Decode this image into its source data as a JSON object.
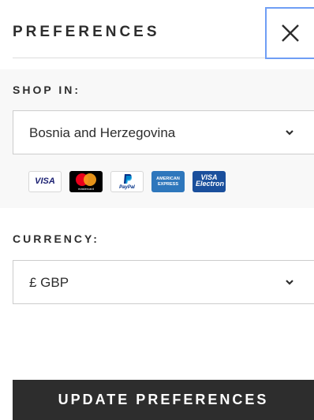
{
  "header": {
    "title": "PREFERENCES"
  },
  "shop": {
    "label": "SHOP IN:",
    "selected_country": "Bosnia and Herzegovina"
  },
  "payment_icons": [
    {
      "name": "visa",
      "text": "VISA",
      "color": "#1a1f71"
    },
    {
      "name": "mastercard",
      "text": "mastercard",
      "color": "#000000"
    },
    {
      "name": "paypal",
      "text": "PayPal",
      "color": "#003087"
    },
    {
      "name": "american-express",
      "text": "AMERICAN EXPRESS",
      "color": "#2e77bc"
    },
    {
      "name": "visa-electron",
      "text": "VISA Electron",
      "color": "#1a4f9c"
    }
  ],
  "currency": {
    "label": "CURRENCY:",
    "selected": "£ GBP"
  },
  "actions": {
    "update_label": "UPDATE PREFERENCES"
  }
}
